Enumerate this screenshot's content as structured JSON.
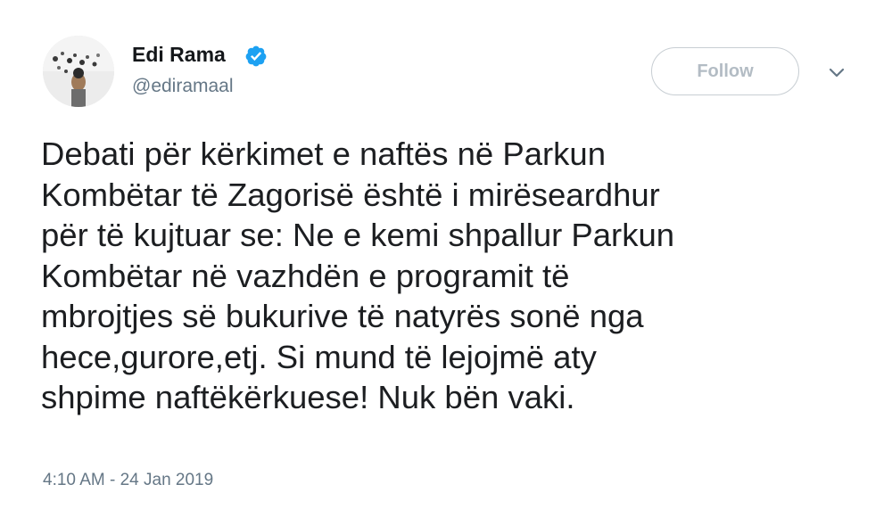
{
  "author": {
    "name": "Edi Rama",
    "handle": "@ediramaal",
    "verified": true
  },
  "follow_button": {
    "label": "Follow"
  },
  "tweet": {
    "lines": [
      "Debati për kërkimet e naftës në Parkun",
      "Kombëtar të Zagorisë është i mirëseardhur",
      "për të kujtuar se: Ne e kemi shpallur Parkun",
      "Kombëtar në vazhdën e programit të",
      "mbrojtjes së bukurive të natyrës sonë nga",
      "hece,gurore,etj. Si mund të lejojmë aty",
      "shpime naftëkërkuese! Nuk bën vaki."
    ],
    "timestamp": "4:10 AM - 24 Jan 2019"
  },
  "colors": {
    "verified_badge": "#1da1f2",
    "handle_text": "#657786",
    "follow_border": "#c8ced3"
  },
  "icons": {
    "verified": "verified-badge-icon",
    "caret": "chevron-down-icon"
  }
}
